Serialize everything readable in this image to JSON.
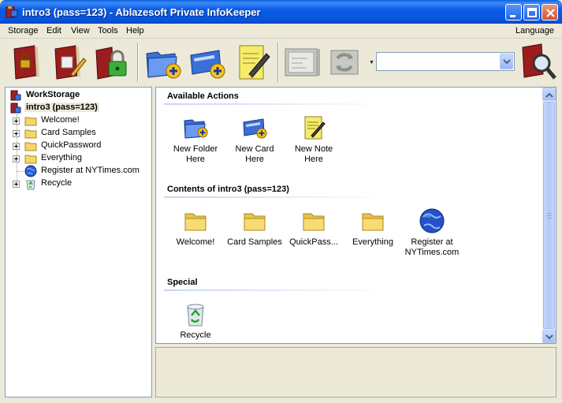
{
  "window": {
    "title": "intro3 (pass=123) - Ablazesoft Private InfoKeeper",
    "controls": {
      "minimize": "minimize",
      "maximize": "maximize",
      "close": "close"
    }
  },
  "menu": {
    "items": [
      "Storage",
      "Edit",
      "View",
      "Tools",
      "Help"
    ],
    "language": "Language"
  },
  "toolbar": {
    "tools": [
      {
        "icon": "lock-book-icon"
      },
      {
        "icon": "edit-book-icon"
      },
      {
        "icon": "padlock-books-icon"
      },
      {
        "icon": "new-folder-icon"
      },
      {
        "icon": "new-card-icon"
      },
      {
        "icon": "new-note-icon"
      },
      {
        "icon": "card-disabled-icon"
      },
      {
        "icon": "sync-disabled-icon"
      },
      {
        "icon": "search-icon"
      }
    ],
    "search_value": ""
  },
  "tree": {
    "storage": "WorkStorage",
    "database": "intro3 (pass=123)",
    "items": [
      {
        "label": "Welcome!",
        "icon": "folder-icon"
      },
      {
        "label": "Card Samples",
        "icon": "folder-icon"
      },
      {
        "label": "QuickPassword",
        "icon": "folder-icon"
      },
      {
        "label": "Everything",
        "icon": "folder-icon"
      },
      {
        "label": "Register at NYTimes.com",
        "icon": "globe-icon"
      },
      {
        "label": "Recycle",
        "icon": "recycle-icon"
      }
    ]
  },
  "main": {
    "available_actions": {
      "heading": "Available Actions",
      "items": [
        {
          "line1": "New Folder",
          "line2": "Here"
        },
        {
          "line1": "New Card",
          "line2": "Here"
        },
        {
          "line1": "New Note",
          "line2": "Here"
        }
      ]
    },
    "contents": {
      "heading": "Contents of intro3 (pass=123)",
      "items": [
        {
          "line1": "Welcome!",
          "line2": ""
        },
        {
          "line1": "Card Samples",
          "line2": ""
        },
        {
          "line1": "QuickPass...",
          "line2": ""
        },
        {
          "line1": "Everything",
          "line2": ""
        },
        {
          "line1": "Register at",
          "line2": "NYTimes.com"
        }
      ]
    },
    "special": {
      "heading": "Special",
      "items": [
        {
          "line1": "Recycle",
          "line2": ""
        }
      ]
    }
  },
  "colors": {
    "titlebar": "#0a5ce6",
    "selection": "#ece9d8",
    "accent": "#316ac5"
  }
}
